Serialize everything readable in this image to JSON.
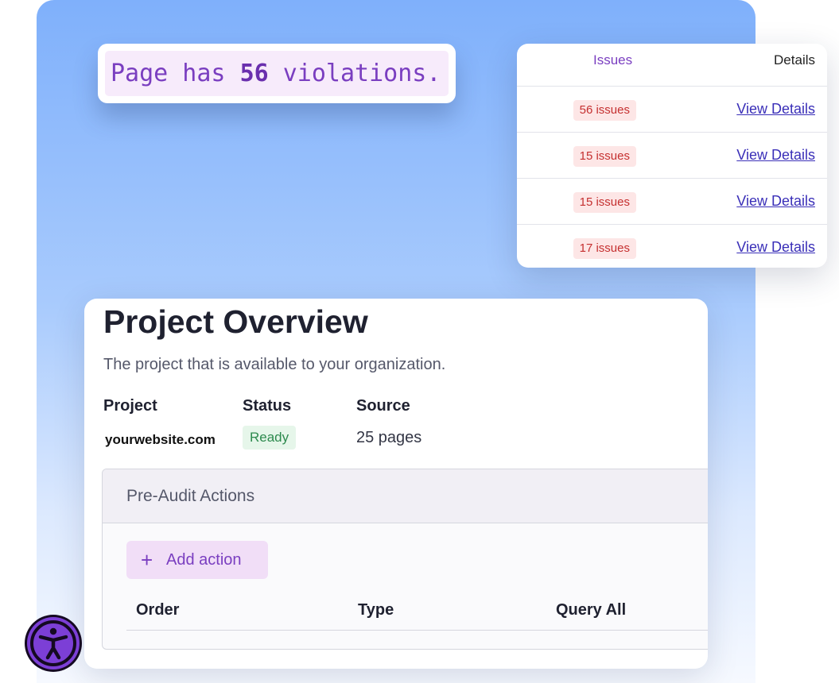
{
  "violations": {
    "prefix": "Page has",
    "count": "56",
    "suffix": "violations."
  },
  "issues_table": {
    "headers": {
      "issues": "Issues",
      "details": "Details"
    },
    "rows": [
      {
        "issues": "56 issues",
        "details": "View Details"
      },
      {
        "issues": "15 issues",
        "details": "View Details"
      },
      {
        "issues": "15 issues",
        "details": "View Details"
      },
      {
        "issues": "17 issues",
        "details": "View Details"
      }
    ]
  },
  "project": {
    "title": "Project Overview",
    "subtitle": "The project that is available to your organization.",
    "labels": {
      "project": "Project",
      "status": "Status",
      "source": "Source"
    },
    "values": {
      "project": "yourwebsite.com",
      "status": "Ready",
      "source": "25 pages"
    }
  },
  "preaudit": {
    "title": "Pre-Audit Actions",
    "add_action_label": "Add action",
    "columns": {
      "order": "Order",
      "type": "Type",
      "query_all": "Query All"
    }
  },
  "colors": {
    "background_gradient_top": "#7fb0fb",
    "accent_purple": "#7a3ec0",
    "issue_red": "#c53030",
    "status_green": "#2d8a4e",
    "link_blue": "#3a2fb8"
  },
  "icons": {
    "add": "plus-icon",
    "accessibility": "accessibility-icon"
  }
}
